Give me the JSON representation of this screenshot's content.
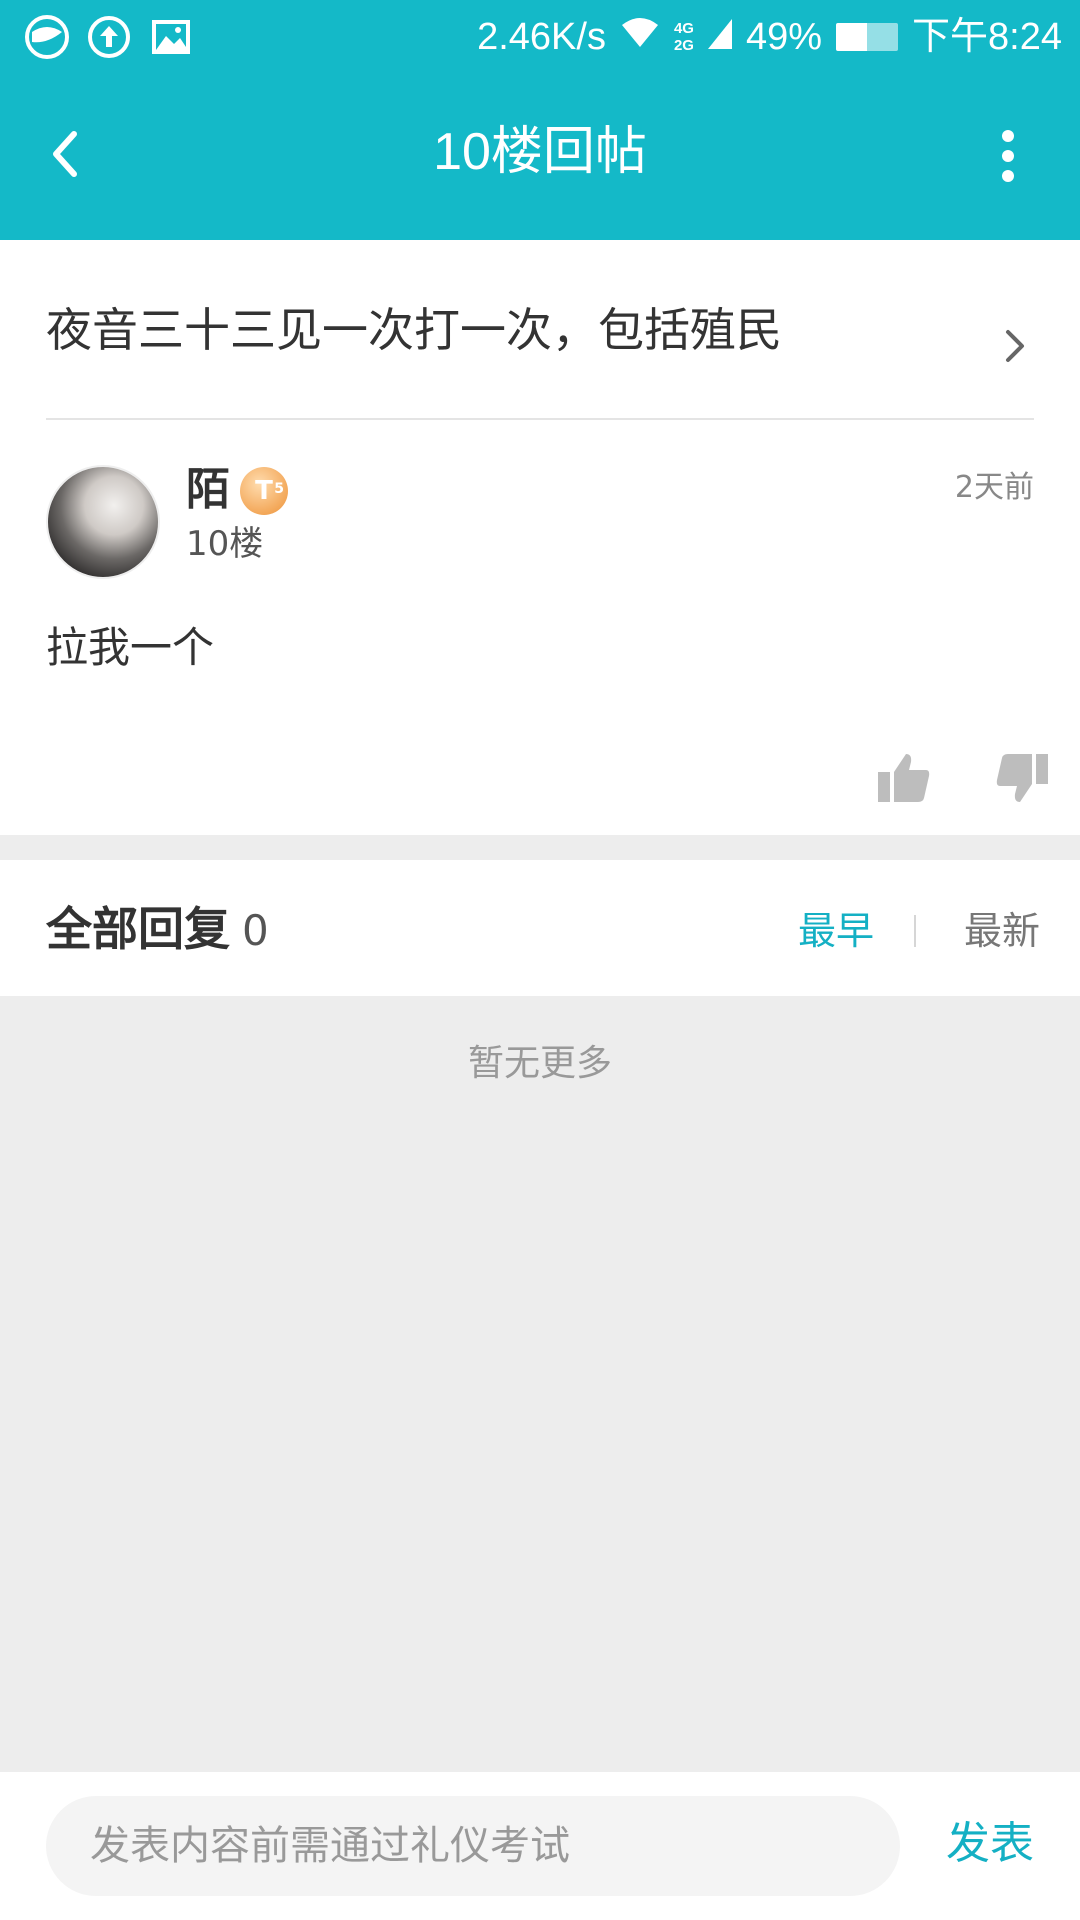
{
  "status_bar": {
    "net_speed": "2.46K/s",
    "net_gen_top": "4G",
    "net_gen_bottom": "2G",
    "battery": "49%",
    "time": "下午8:24"
  },
  "header": {
    "title": "10楼回帖",
    "back_icon": "back-arrow-icon",
    "more_icon": "more-vertical-icon"
  },
  "thread": {
    "title": "夜音三十三见一次打一次，包括殖民"
  },
  "post": {
    "username": "陌",
    "badge": "T",
    "badge_sub": "5",
    "floor": "10楼",
    "time": "2天前",
    "content": "拉我一个"
  },
  "replies": {
    "title": "全部回复",
    "count": "0",
    "sort_earliest": "最早",
    "sort_newest": "最新",
    "empty_text": "暂无更多"
  },
  "compose": {
    "placeholder": "发表内容前需通过礼仪考试",
    "send_label": "发表"
  },
  "colors": {
    "accent": "#14b9c8",
    "link": "#14b0c4"
  }
}
